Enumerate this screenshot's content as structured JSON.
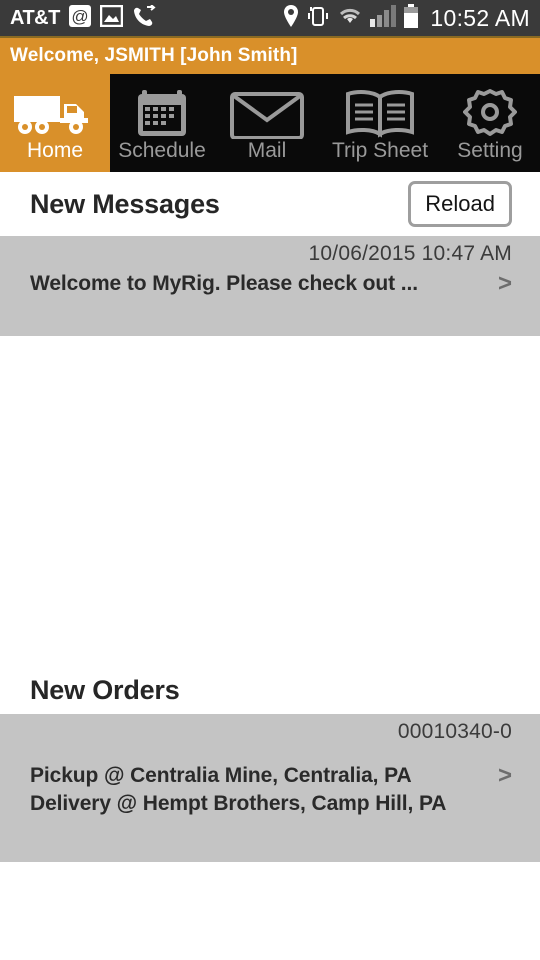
{
  "status_bar": {
    "carrier": "AT&T",
    "time": "10:52 AM",
    "left_icons": [
      "email-at-icon",
      "photo-image-icon",
      "call-forward-icon"
    ],
    "right_icons": [
      "location-pin-icon",
      "vibrate-mode-icon",
      "wifi-icon",
      "signal-bars-icon",
      "battery-icon"
    ]
  },
  "welcome": {
    "text": "Welcome, JSMITH [John Smith]"
  },
  "tabs": [
    {
      "label": "Home",
      "icon": "truck-icon",
      "active": true
    },
    {
      "label": "Schedule",
      "icon": "calendar-icon",
      "active": false
    },
    {
      "label": "Mail",
      "icon": "envelope-icon",
      "active": false
    },
    {
      "label": "Trip Sheet",
      "icon": "open-book-icon",
      "active": false
    },
    {
      "label": "Setting",
      "icon": "gear-icon",
      "active": false
    }
  ],
  "messages_section": {
    "title": "New Messages",
    "reload_label": "Reload",
    "items": [
      {
        "timestamp": "10/06/2015 10:47 AM",
        "text": "Welcome to MyRig.   Please check out ...",
        "chevron": ">"
      }
    ]
  },
  "orders_section": {
    "title": "New Orders",
    "items": [
      {
        "order_number": "00010340-0",
        "pickup": "Pickup @ Centralia Mine, Centralia, PA",
        "delivery": "Delivery @ Hempt Brothers, Camp Hill, PA",
        "chevron": ">"
      }
    ]
  },
  "colors": {
    "accent_orange": "#d9902a",
    "tab_bar_black": "#0a0a0a",
    "list_gray": "#c4c4c4",
    "status_bar_gray": "#3a3a3a"
  }
}
